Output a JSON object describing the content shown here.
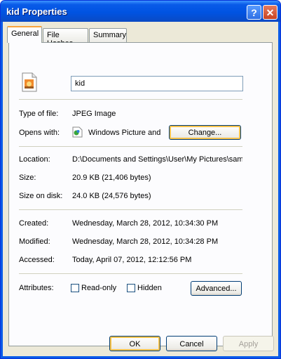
{
  "window": {
    "title": "kid Properties",
    "help_glyph": "?",
    "close_glyph": "✕"
  },
  "tabs": [
    "General",
    "File Hashes",
    "Summary"
  ],
  "general": {
    "filename": "kid",
    "type_label": "Type of file:",
    "type_value": "JPEG Image",
    "opens_label": "Opens with:",
    "opens_value": "Windows Picture and F",
    "change_button": "Change...",
    "location_label": "Location:",
    "location_value": "D:\\Documents and Settings\\User\\My Pictures\\samp",
    "size_label": "Size:",
    "size_value": "20.9 KB (21,406 bytes)",
    "size_on_disk_label": "Size on disk:",
    "size_on_disk_value": "24.0 KB (24,576 bytes)",
    "created_label": "Created:",
    "created_value": "Wednesday, March 28, 2012, 10:34:30 PM",
    "modified_label": "Modified:",
    "modified_value": "Wednesday, March 28, 2012, 10:34:28 PM",
    "accessed_label": "Accessed:",
    "accessed_value": "Today, April 07, 2012, 12:12:56 PM",
    "attributes_label": "Attributes:",
    "readonly_label": "Read-only",
    "hidden_label": "Hidden",
    "advanced_button": "Advanced..."
  },
  "footer": {
    "ok": "OK",
    "cancel": "Cancel",
    "apply": "Apply"
  },
  "colors": {
    "title_bar": "#0a5be8",
    "dialog_face": "#ece9d8",
    "focus_ring": "#f7c34b"
  }
}
